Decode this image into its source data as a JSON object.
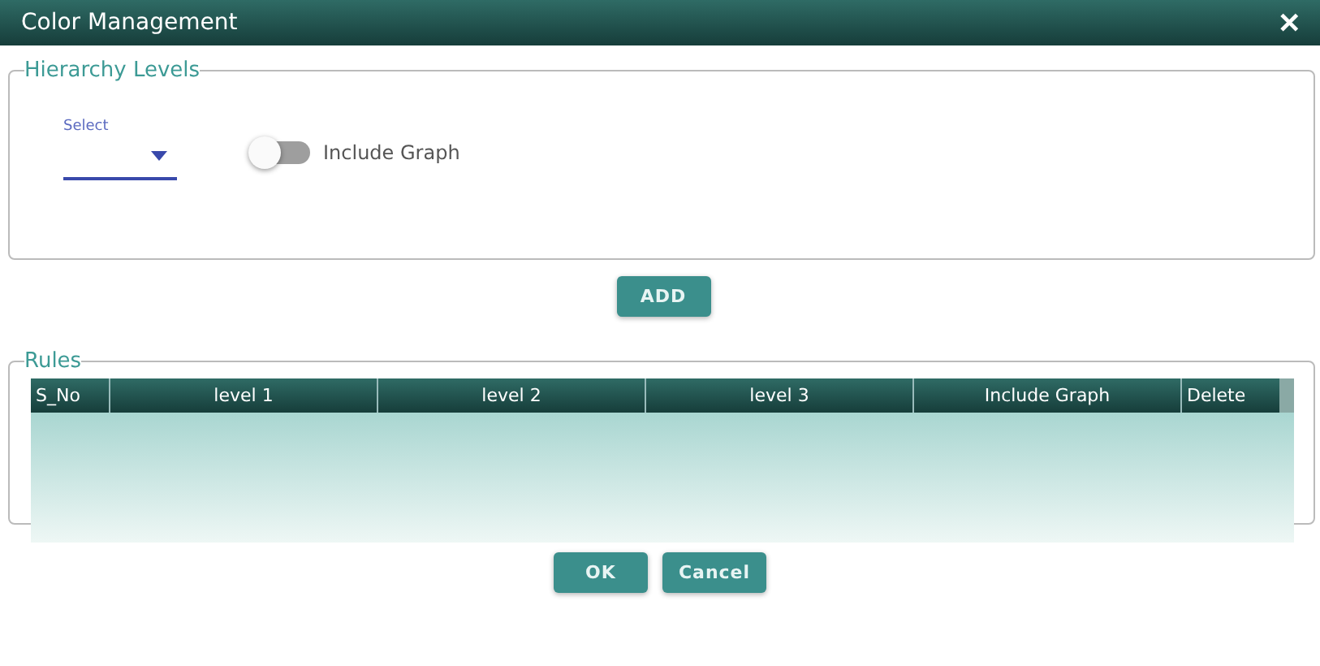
{
  "window": {
    "title": "Color Management",
    "close": "✕"
  },
  "hierarchy": {
    "legend": "Hierarchy Levels",
    "select": {
      "label": "Select"
    },
    "toggle": {
      "label": "Include Graph",
      "on": false
    }
  },
  "add_button": "ADD",
  "rules": {
    "legend": "Rules",
    "columns": [
      "S_No",
      "level 1",
      "level 2",
      "level 3",
      "Include Graph",
      "Delete"
    ]
  },
  "buttons": [
    "OK",
    "Cancel"
  ]
}
